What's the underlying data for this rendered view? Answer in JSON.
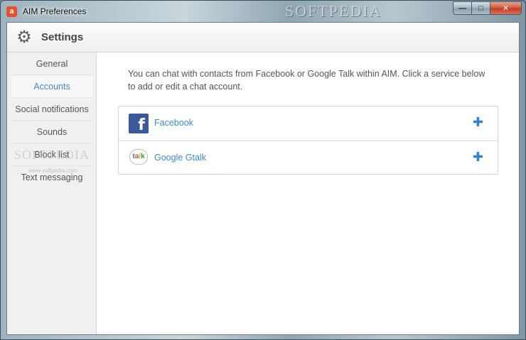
{
  "window": {
    "title": "AIM Preferences",
    "app_icon_glyph": "a",
    "watermark": "SOFTPEDIA",
    "caption": {
      "minimize": "—",
      "maximize": "□",
      "close": "✕"
    }
  },
  "header": {
    "icon": "gear-icon",
    "title": "Settings"
  },
  "sidebar": {
    "items": [
      {
        "label": "General",
        "active": false
      },
      {
        "label": "Accounts",
        "active": true
      },
      {
        "label": "Social notifications",
        "active": false
      },
      {
        "label": "Sounds",
        "active": false
      },
      {
        "label": "Block list",
        "active": false
      },
      {
        "label": "Text messaging",
        "active": false
      }
    ],
    "watermark": "SOFTPEDIA",
    "watermark_url": "www.softpedia.com"
  },
  "content": {
    "intro": "You can chat with contacts from Facebook or Google Talk within AIM. Click a service below to add or edit a chat account.",
    "services": [
      {
        "name": "Facebook",
        "icon": "facebook-icon",
        "action_icon": "plus-icon",
        "icon_glyph": "f"
      },
      {
        "name": "Google Gtalk",
        "icon": "google-talk-icon",
        "action_icon": "plus-icon",
        "icon_glyph": "talk"
      }
    ]
  },
  "colors": {
    "accent": "#3b8bd1",
    "facebook": "#3b5998",
    "plus": "#2f86d6"
  }
}
